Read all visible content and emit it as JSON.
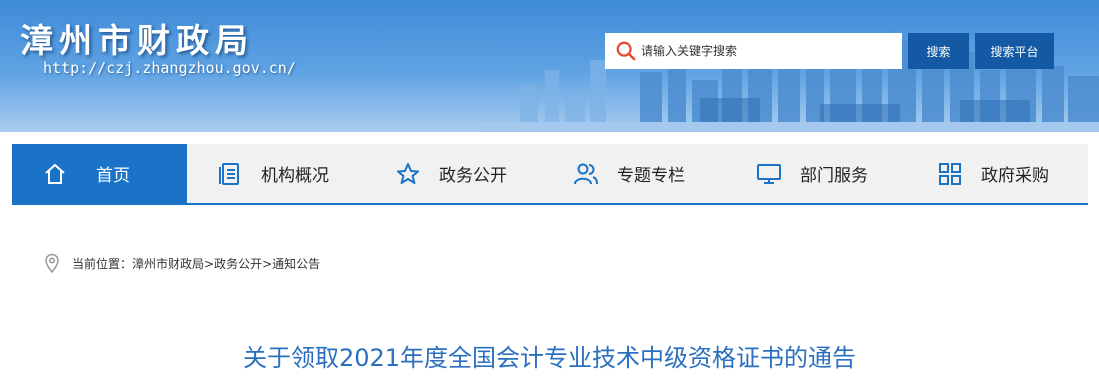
{
  "header": {
    "site_title": "漳州市财政局",
    "site_url": "http://czj.zhangzhou.gov.cn/",
    "search_placeholder": "请输入关键字搜索",
    "search_button": "搜索",
    "platform_button": "搜索平台"
  },
  "nav": {
    "items": [
      {
        "label": "首页",
        "icon": "home-icon"
      },
      {
        "label": "机构概况",
        "icon": "document-icon"
      },
      {
        "label": "政务公开",
        "icon": "star-icon"
      },
      {
        "label": "专题专栏",
        "icon": "users-icon"
      },
      {
        "label": "部门服务",
        "icon": "monitor-icon"
      },
      {
        "label": "政府采购",
        "icon": "grid-icon"
      }
    ]
  },
  "breadcrumb": {
    "prefix": "当前位置：",
    "path": "漳州市财政局>政务公开>通知公告"
  },
  "article": {
    "title": "关于领取2021年度全国会计专业技术中级资格证书的通告"
  },
  "colors": {
    "accent": "#1a73c7",
    "button": "#1359a4",
    "title": "#2b6fc0"
  }
}
